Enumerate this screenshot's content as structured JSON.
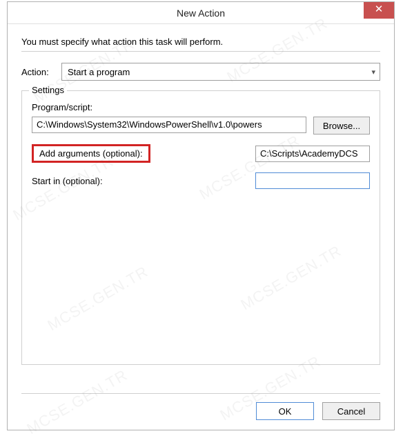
{
  "window": {
    "title": "New Action"
  },
  "instruction": "You must specify what action this task will perform.",
  "action": {
    "label": "Action:",
    "selected": "Start a program"
  },
  "settings": {
    "legend": "Settings",
    "program_label": "Program/script:",
    "program_value": "C:\\Windows\\System32\\WindowsPowerShell\\v1.0\\powers",
    "browse_label": "Browse...",
    "add_args_label": "Add arguments (optional):",
    "add_args_value": "C:\\Scripts\\AcademyDCS",
    "start_in_label": "Start in (optional):",
    "start_in_value": ""
  },
  "buttons": {
    "ok": "OK",
    "cancel": "Cancel"
  },
  "watermark": "MCSE.GEN.TR"
}
